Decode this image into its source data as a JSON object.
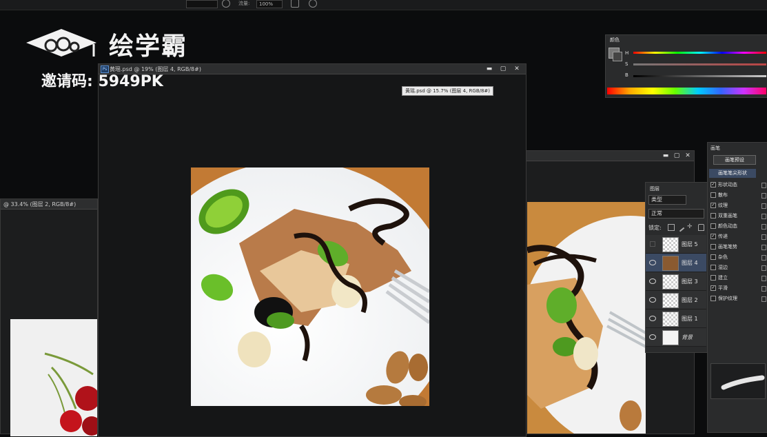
{
  "options_bar": {
    "flow_label": "流量:",
    "flow_value": "100%"
  },
  "watermark": {
    "brand": "绘学霸",
    "invite": "邀请码: 5949PK"
  },
  "main_window": {
    "title": "黄瑶.psd @ 19% (图层 4, RGB/8#)",
    "tooltip": "黄瑶.psd @ 15.7% (图层 4, RGB/8#)",
    "min": "▬",
    "max": "▢",
    "close": "✕"
  },
  "left_window": {
    "title": "@ 33.4% (图层 2, RGB/8#)"
  },
  "color_panel": {
    "tab": "颜色",
    "h": "H",
    "s": "S",
    "b": "B"
  },
  "layers_panel": {
    "tab": "图层",
    "filter": "类型",
    "blend_mode": "正常",
    "lock_label": "锁定:",
    "layers": [
      {
        "name": "图层 5",
        "visible": false
      },
      {
        "name": "图层 4",
        "visible": true,
        "selected": true
      },
      {
        "name": "图层 3",
        "visible": true
      },
      {
        "name": "图层 2",
        "visible": true
      },
      {
        "name": "图层 1",
        "visible": true
      },
      {
        "name": "背景",
        "visible": true
      }
    ]
  },
  "brush_panel": {
    "tab": "画笔",
    "preset_button": "画笔预设",
    "tip_header": "画笔笔尖形状",
    "options": [
      {
        "label": "形状动态",
        "checked": true
      },
      {
        "label": "散布",
        "checked": false
      },
      {
        "label": "纹理",
        "checked": true
      },
      {
        "label": "双重画笔",
        "checked": false
      },
      {
        "label": "颜色动态",
        "checked": false
      },
      {
        "label": "传递",
        "checked": true
      },
      {
        "label": "画笔笔势",
        "checked": false
      },
      {
        "label": "杂色",
        "checked": false
      },
      {
        "label": "湿边",
        "checked": false
      },
      {
        "label": "建立",
        "checked": false
      },
      {
        "label": "平滑",
        "checked": true
      },
      {
        "label": "保护纹理",
        "checked": false
      }
    ]
  },
  "colors": {
    "accent_blue": "#3b4a63",
    "panel_bg": "#2a2b2c",
    "kiwi_green": "#5fae2a",
    "chocolate": "#1e120c"
  }
}
